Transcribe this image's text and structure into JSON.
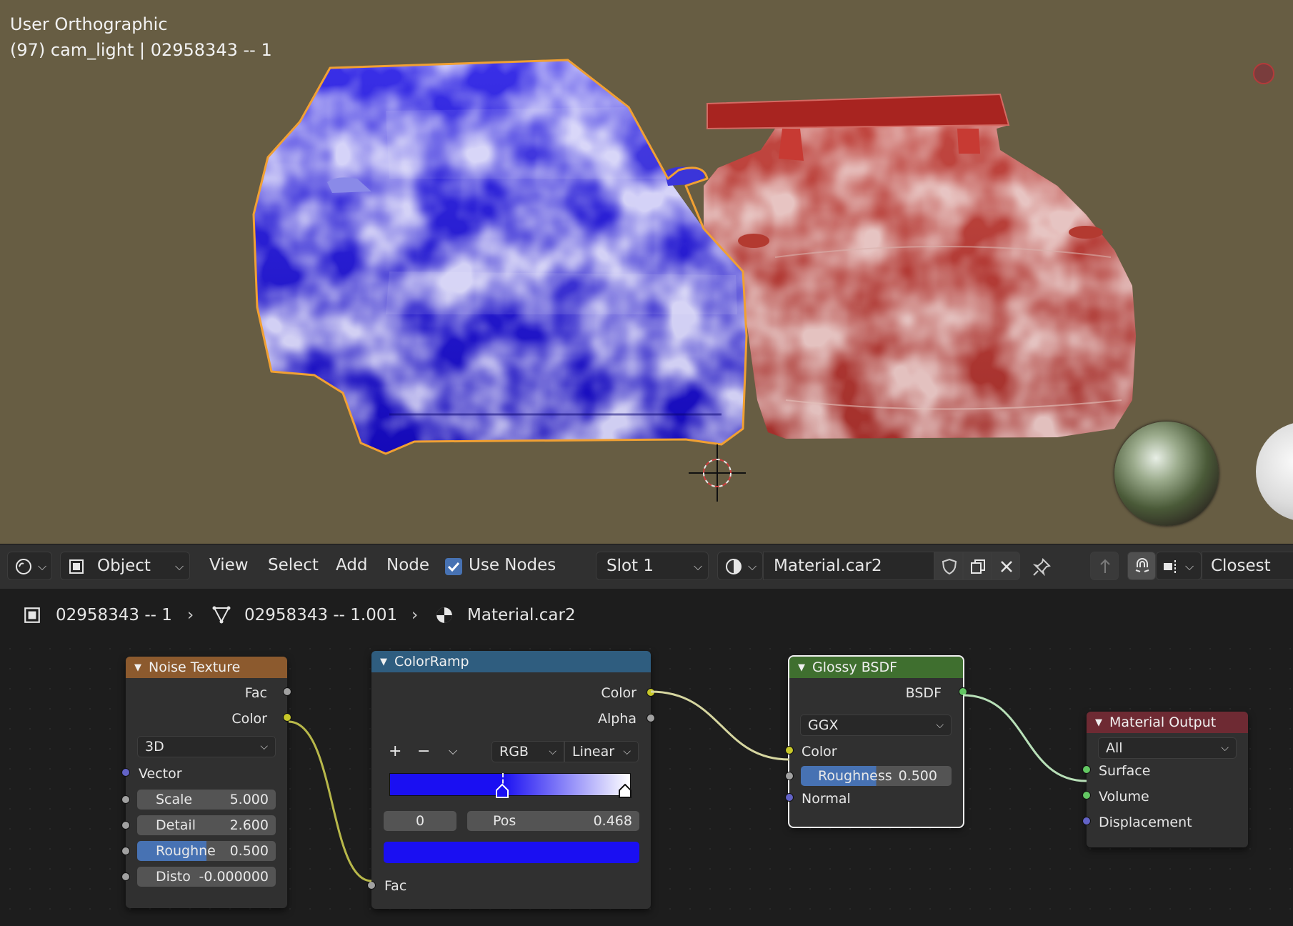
{
  "viewport": {
    "title": "User Orthographic",
    "info": "(97) cam_light | 02958343 -- 1",
    "colors": {
      "background": "#675d43",
      "selection_outline": "#f0a033",
      "car_blue": "#1a0fd6",
      "car_red": "#b8231e"
    }
  },
  "header": {
    "mode_label": "Object",
    "menu": [
      "View",
      "Select",
      "Add",
      "Node"
    ],
    "use_nodes_label": "Use Nodes",
    "use_nodes_checked": true,
    "slot_label": "Slot 1",
    "material_name": "Material.car2",
    "snap_label": "Closest",
    "icons": [
      "editor-type-icon",
      "object-icon",
      "browse-material-icon",
      "fake-user-shield-icon",
      "duplicate-icon",
      "unlink-x-icon",
      "pin-icon",
      "parent-tree-icon",
      "snap-magnet-icon",
      "snap-target-icon"
    ]
  },
  "breadcrumb": {
    "object": "02958343 -- 1",
    "mesh": "02958343 -- 1.001",
    "material": "Material.car2"
  },
  "nodes": {
    "noise": {
      "title": "Noise Texture",
      "header_color": "#8c5a2e",
      "outputs": [
        "Fac",
        "Color"
      ],
      "dimensions": "3D",
      "vector_label": "Vector",
      "fields": [
        {
          "label": "Scale",
          "value": "5.000"
        },
        {
          "label": "Detail",
          "value": "2.600"
        },
        {
          "label": "Roughne",
          "value": "0.500",
          "fill": 0.5
        },
        {
          "label": "Disto",
          "value": "-0.000000"
        }
      ]
    },
    "colorramp": {
      "title": "ColorRamp",
      "header_color": "#2f5d7f",
      "outputs": [
        "Color",
        "Alpha"
      ],
      "color_mode": "RGB",
      "interpolation": "Linear",
      "stop_index": "0",
      "pos_label": "Pos",
      "pos_value": "0.468",
      "stop_color": "#1a0ff2",
      "ramp_start": "#1a0ff2",
      "ramp_end": "#ffffff",
      "input_label": "Fac"
    },
    "glossy": {
      "title": "Glossy BSDF",
      "header_color": "#3f6f2f",
      "output": "BSDF",
      "distribution": "GGX",
      "color_label": "Color",
      "roughness_label": "Roughness",
      "roughness_value": "0.500",
      "roughness_fill": 0.5,
      "normal_label": "Normal"
    },
    "output": {
      "title": "Material Output",
      "header_color": "#6e2a33",
      "target": "All",
      "inputs": [
        "Surface",
        "Volume",
        "Displacement"
      ]
    }
  }
}
